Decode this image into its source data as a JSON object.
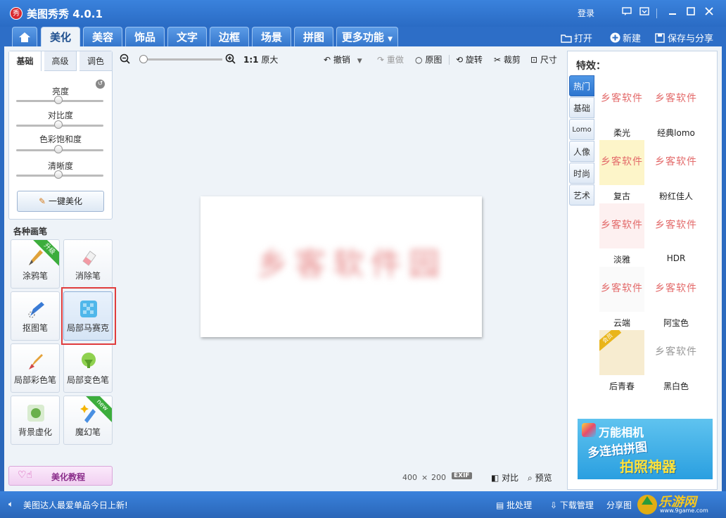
{
  "window": {
    "logo_char": "秀",
    "title": "美图秀秀 4.0.1",
    "login": "登录"
  },
  "tabs": [
    {
      "label": "美化",
      "active": true
    },
    {
      "label": "美容"
    },
    {
      "label": "饰品"
    },
    {
      "label": "文字"
    },
    {
      "label": "边框"
    },
    {
      "label": "场景"
    },
    {
      "label": "拼图"
    },
    {
      "label": "更多功能"
    }
  ],
  "top_actions": {
    "open": "打开",
    "new": "新建",
    "save_share": "保存与分享"
  },
  "left": {
    "subtabs": [
      "基础",
      "高级",
      "调色"
    ],
    "sliders": [
      {
        "label": "亮度",
        "value": 50
      },
      {
        "label": "对比度",
        "value": 50
      },
      {
        "label": "色彩饱和度",
        "value": 50
      },
      {
        "label": "清晰度",
        "value": 50
      }
    ],
    "beautify_button": "一键美化",
    "brush_heading": "各种画笔",
    "brushes": [
      {
        "label": "涂鸦笔",
        "ribbon": "升级"
      },
      {
        "label": "消除笔"
      },
      {
        "label": "抠图笔"
      },
      {
        "label": "局部马赛克",
        "selected": true
      },
      {
        "label": "局部彩色笔"
      },
      {
        "label": "局部变色笔"
      },
      {
        "label": "背景虚化"
      },
      {
        "label": "魔幻笔",
        "ribbon": "new"
      }
    ],
    "tutorial": "美化教程"
  },
  "toolbar": {
    "zoom_ratio": "1:1",
    "original_size": "原大",
    "undo": "撤销",
    "redo": "重做",
    "original": "原图",
    "rotate": "旋转",
    "crop": "裁剪",
    "size": "尺寸",
    "zoom_percent": 0
  },
  "canvas": {
    "text": "乡客软件园",
    "width_text": "400",
    "times": "×",
    "height_text": "200",
    "exif": "EXIF",
    "compare": "对比",
    "preview": "预览"
  },
  "effects": {
    "heading": "特效：",
    "categories": [
      "热门",
      "基础",
      "Lomo",
      "人像",
      "时尚",
      "艺术"
    ],
    "thumb_text": "乡客软件",
    "items": [
      {
        "label": "柔光"
      },
      {
        "label": "经典lomo"
      },
      {
        "label": "复古"
      },
      {
        "label": "粉红佳人"
      },
      {
        "label": "淡雅"
      },
      {
        "label": "HDR"
      },
      {
        "label": "云端"
      },
      {
        "label": "阿宝色"
      },
      {
        "label": "后青春",
        "badge": "会员"
      },
      {
        "label": "黑白色"
      }
    ],
    "ad": {
      "title": "万能相机",
      "line1": "多连拍拼图",
      "line2": "拍照神器"
    }
  },
  "statusbar": {
    "news": "美图达人最爱单品今日上新!",
    "batch": "批处理",
    "download": "下载管理",
    "share": "分享图"
  },
  "watermark": {
    "text": "乐游网",
    "sub": "www.9game.com"
  }
}
